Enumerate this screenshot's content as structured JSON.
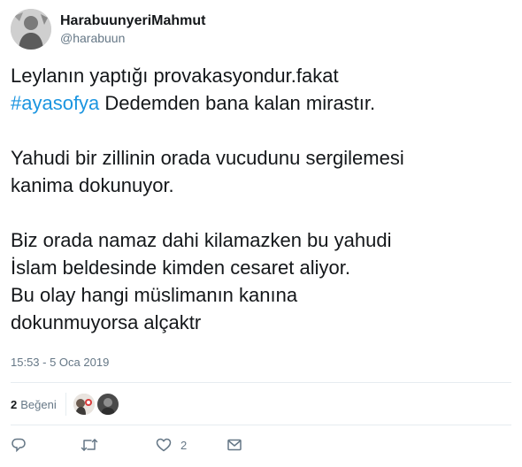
{
  "author": {
    "display_name": "HarabuunyeriMahmut",
    "handle": "@harabuun"
  },
  "tweet": {
    "line1": "Leylanın yaptığı provakasyondur.fakat",
    "hashtag": "#ayasofya",
    "line2_rest": " Dedemden bana kalan mirastır.",
    "line3": "Yahudi bir zillinin orada vucudunu sergilemesi",
    "line4": "kanima dokunuyor.",
    "line5": "Biz orada namaz dahi kilamazken bu yahudi",
    "line6": "İslam beldesinde kimden cesaret aliyor.",
    "line7": "Bu olay hangi müslimanın kanına",
    "line8": "dokunmuyorsa alçaktr"
  },
  "timestamp": "15:53 - 5 Oca 2019",
  "likes": {
    "count": "2",
    "label": "Beğeni"
  },
  "actions": {
    "reply_icon": "reply-icon",
    "retweet_icon": "retweet-icon",
    "like_icon": "heart-icon",
    "like_count": "2",
    "dm_icon": "envelope-icon"
  },
  "colors": {
    "link": "#1b95e0",
    "secondary": "#657786",
    "text": "#14171a",
    "divider": "#e6ecf0"
  }
}
